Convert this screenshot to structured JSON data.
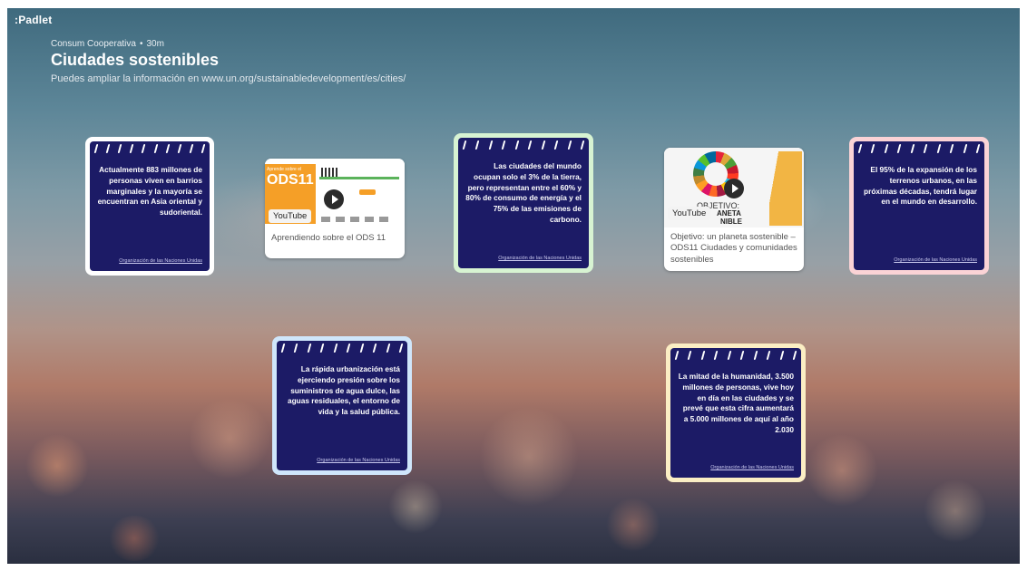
{
  "app": {
    "logo": ":Padlet"
  },
  "header": {
    "author": "Consum Cooperativa",
    "separator": "•",
    "time": "30m",
    "title": "Ciudades sostenibles",
    "subtitle": "Puedes ampliar la información en www.un.org/sustainabledevelopment/es/cities/"
  },
  "posts": {
    "note1": {
      "text": "Actualmente 883 millones de personas viven en barrios marginales y la mayoría se encuentran en Asia oriental y sudoriental.",
      "source": "Organización de las Naciones Unidas",
      "border_color": "#ffffff"
    },
    "video1": {
      "badge": "YouTube",
      "thumb_text": "ODS11",
      "thumb_small": "Aprende sobre el",
      "caption": "Aprendiendo sobre el ODS 11"
    },
    "note2": {
      "text": "Las ciudades del mundo ocupan solo el 3% de la tierra, pero representan entre el 60% y 80% de consumo de energía y el 75% de las emisiones de carbono.",
      "source": "Organización de las Naciones Unidas",
      "border_color": "#d7f3d2"
    },
    "video2": {
      "badge": "YouTube",
      "thumb_line1": "OBJETIVO:",
      "thumb_line2": "ANETA",
      "thumb_line3": "NIBLE",
      "caption": "Objetivo: un planeta sostenible – ODS11 Ciudades y comunidades sostenibles"
    },
    "note3": {
      "text": "El 95% de la expansión de los terrenos urbanos, en las próximas décadas, tendrá lugar en el mundo en desarrollo.",
      "source": "Organización de las Naciones Unidas",
      "border_color": "#fbd3d6"
    },
    "note4": {
      "text": "La rápida urbanización está ejerciendo presión sobre los suministros de agua dulce, las aguas residuales, el entorno de vida y la salud pública.",
      "source": "Organización de las Naciones Unidas",
      "border_color": "#cfe6fb"
    },
    "note5": {
      "text": "La mitad de la humanidad, 3.500 millones de personas, vive hoy en día en las ciudades y se prevé que esta cifra aumentará a 5.000 millones de aquí al año 2.030",
      "source": "Organización de las Naciones Unidas",
      "border_color": "#fbeec4"
    }
  },
  "colors": {
    "note_background": "#1c1b66",
    "ods_orange": "#f59f27"
  }
}
